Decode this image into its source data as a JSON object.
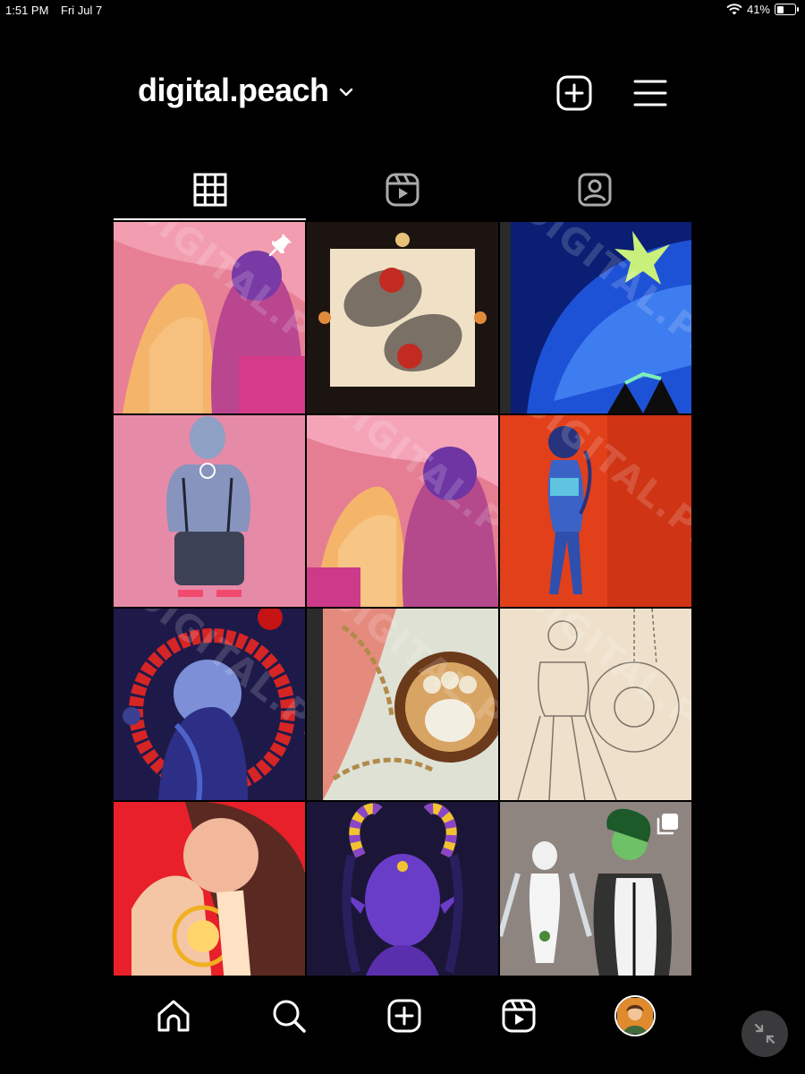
{
  "status_bar": {
    "time": "1:51 PM",
    "date": "Fri Jul 7",
    "battery": "41%",
    "battery_level": 0.41
  },
  "header": {
    "username": "digital.peach"
  },
  "tabs": [
    "posts-grid",
    "reels",
    "tagged"
  ],
  "posts": [
    {
      "watermark": "DIGITAL.PEACH",
      "pinned": true
    },
    {
      "watermark": ""
    },
    {
      "watermark": "DIGITAL.PEACH"
    },
    {
      "watermark": ""
    },
    {
      "watermark": "DIGITAL.PEACH"
    },
    {
      "watermark": "DIGITAL.PEACH"
    },
    {
      "watermark": "DIGITAL.PEACH"
    },
    {
      "watermark": "DIGITAL.PEACH"
    },
    {
      "watermark": "DIGITAL.PEACH"
    },
    {
      "watermark": ""
    },
    {
      "watermark": ""
    },
    {
      "watermark": "",
      "multiple": true
    }
  ],
  "bottom_nav": [
    "home-icon",
    "search-icon",
    "new-post-icon",
    "reels-icon",
    "profile-avatar"
  ],
  "colors": {
    "background": "#000000",
    "text": "#ffffff",
    "fab": "#3a3a3c"
  }
}
